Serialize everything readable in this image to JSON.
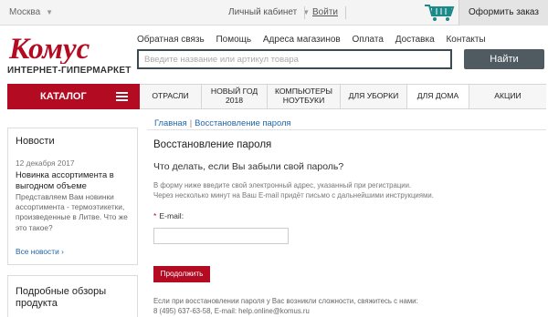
{
  "topbar": {
    "city": "Москва",
    "cabinet": "Личный кабинет",
    "login": "Войти",
    "order": "Оформить заказ"
  },
  "header": {
    "logo_text": "Комус",
    "logo_sub": "ИНТЕРНЕТ-ГИПЕРМАРКЕТ",
    "nav": [
      "Обратная связь",
      "Помощь",
      "Адреса магазинов",
      "Оплата",
      "Доставка",
      "Контакты"
    ],
    "search_placeholder": "Введите название или артикул товара",
    "find_button": "Найти"
  },
  "catalog": {
    "label": "КАТАЛОГ",
    "tabs": [
      {
        "label": "ОТРАСЛИ"
      },
      {
        "label": "НОВЫЙ ГОД\n2018"
      },
      {
        "label": "КОМПЬЮТЕРЫ\nНОУТБУКИ"
      },
      {
        "label": "ДЛЯ УБОРКИ"
      },
      {
        "label": "ДЛЯ ДОМА"
      },
      {
        "label": "АКЦИИ"
      }
    ]
  },
  "sidebar": {
    "news_title": "Новости",
    "news_date": "12 декабря 2017",
    "news_headline": "Новинка ассортимента в выгодном объеме",
    "news_text": "Представляем Вам новинки ассортимента - термоэтикетки, произведенные в Литве. Что же это такое?",
    "news_all": "Все новости ›",
    "reviews_title": "Подробные обзоры продукта"
  },
  "main": {
    "breadcrumb_home": "Главная",
    "breadcrumb_sep": "|",
    "breadcrumb_current": "Восстановление пароля",
    "title": "Восстановление пароля",
    "question": "Что делать, если Вы забыли свой пароль?",
    "info_line1": "В форму ниже введите свой электронный адрес, указанный при регистрации.",
    "info_line2": "Через несколько минут на Ваш E-mail придёт письмо с дальнейшими инструкциями.",
    "email_required": "*",
    "email_label": "E-mail:",
    "email_value": "",
    "submit": "Продолжить",
    "help_line1": "Если при восстановлении пароля у Вас возникли сложности, свяжитесь с нами:",
    "help_line2": "8 (495) 637-63-58, E-mail: help.online@komus.ru"
  },
  "colors": {
    "brand_red": "#b30c22",
    "search_border": "#3c4a52",
    "find_button_bg": "#4f5a61",
    "link": "#2266aa"
  },
  "icons": [
    "chevron-down-icon",
    "cart-icon",
    "menu-icon"
  ]
}
